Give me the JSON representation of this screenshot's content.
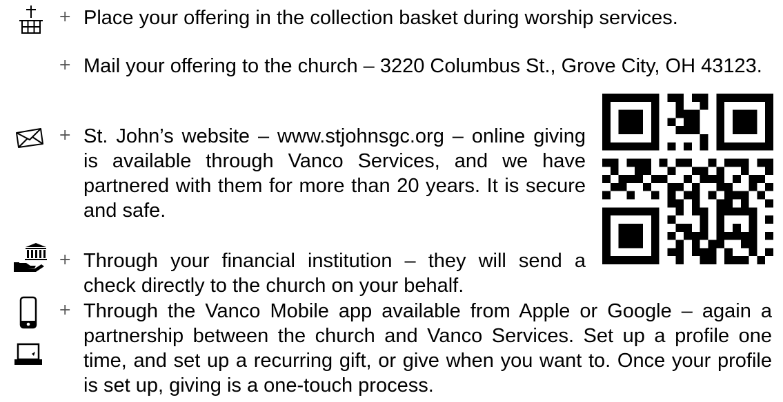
{
  "giving_options": [
    {
      "icon": "church-building-icon",
      "text": "Place your offering in the collection basket during worship services."
    },
    {
      "icon": "",
      "text": "Mail your offering to the church – 3220 Columbus St., Grove City, OH 43123."
    },
    {
      "icon": "envelope-icon",
      "text": "St. John’s website – www.stjohnsgc.org – online giving is available through Vanco Services, and we have partnered with them for more than 20 years. It is secure and safe."
    },
    {
      "icon": "hand-bank-icon",
      "text": "Through your financial institution – they will send a check directly to the church on your behalf."
    },
    {
      "icon": "mobile-phone-icon",
      "secondary_icon": "laptop-icon",
      "text": "Through the Vanco Mobile app available from Apple or Google – again a partnership between the church and Vanco Services. Set up a profile one time, and set up a recurring gift, or give when you want to. Once your profile is set up, giving is a one-touch process."
    }
  ],
  "bullet_symbol": "+",
  "colors": {
    "text": "#000000",
    "bullet": "#555555"
  }
}
